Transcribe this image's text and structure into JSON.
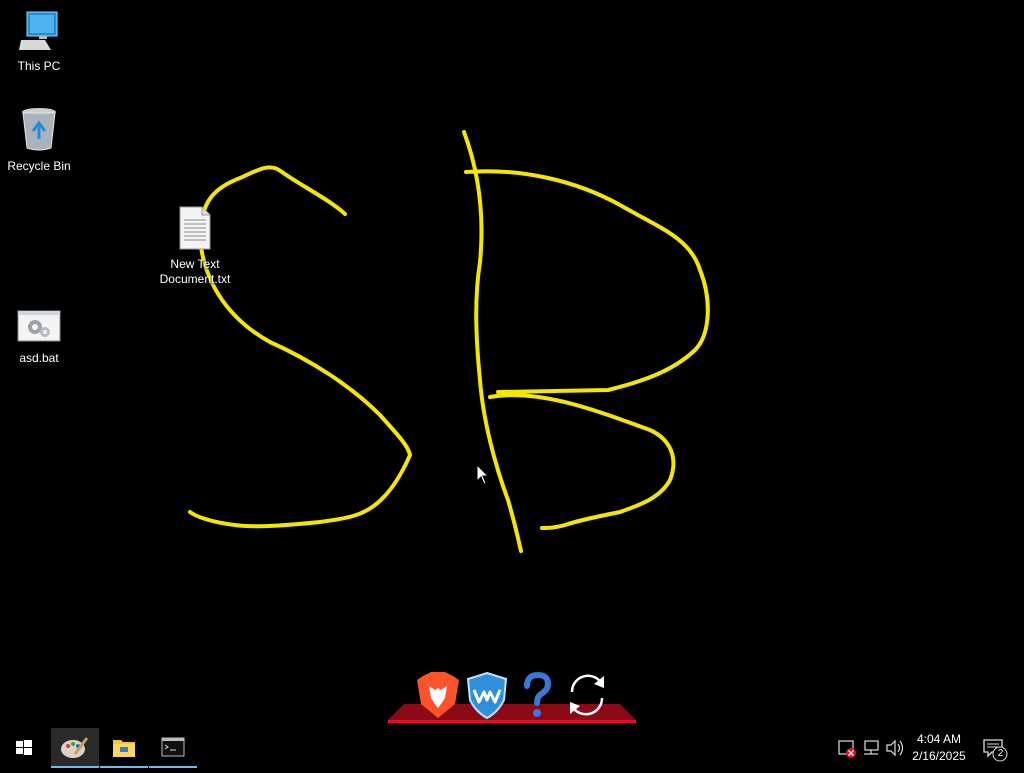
{
  "desktop": {
    "icons": [
      {
        "label": "This PC",
        "icon": "this-pc-icon"
      },
      {
        "label": "Recycle Bin",
        "icon": "recycle-bin-icon"
      },
      {
        "label": "New Text Document.txt",
        "icon": "text-file-icon"
      },
      {
        "label": "asd.bat",
        "icon": "batch-file-icon"
      }
    ],
    "drawing": {
      "color": "#f5e600",
      "glyphs": "SB"
    }
  },
  "dock": {
    "items": [
      {
        "name": "Brave",
        "icon": "brave-lion-icon"
      },
      {
        "name": "Wise Care",
        "icon": "shield-wave-icon"
      },
      {
        "name": "Help",
        "icon": "question-mark-icon"
      },
      {
        "name": "Refresh",
        "icon": "refresh-icon"
      }
    ]
  },
  "taskbar": {
    "items": [
      {
        "icon": "start-windows-icon"
      },
      {
        "icon": "paint-app-icon",
        "active": true
      },
      {
        "icon": "file-explorer-icon"
      },
      {
        "icon": "command-prompt-icon"
      }
    ],
    "tray": {
      "icons": [
        "security-alert-icon",
        "network-icon",
        "volume-icon"
      ],
      "time": "4:04 AM",
      "date": "2/16/2025",
      "notification_count": "2"
    }
  },
  "colors": {
    "accent": "#76b9ed",
    "stroke": "#f5e600",
    "dock_red": "#c8102e"
  }
}
